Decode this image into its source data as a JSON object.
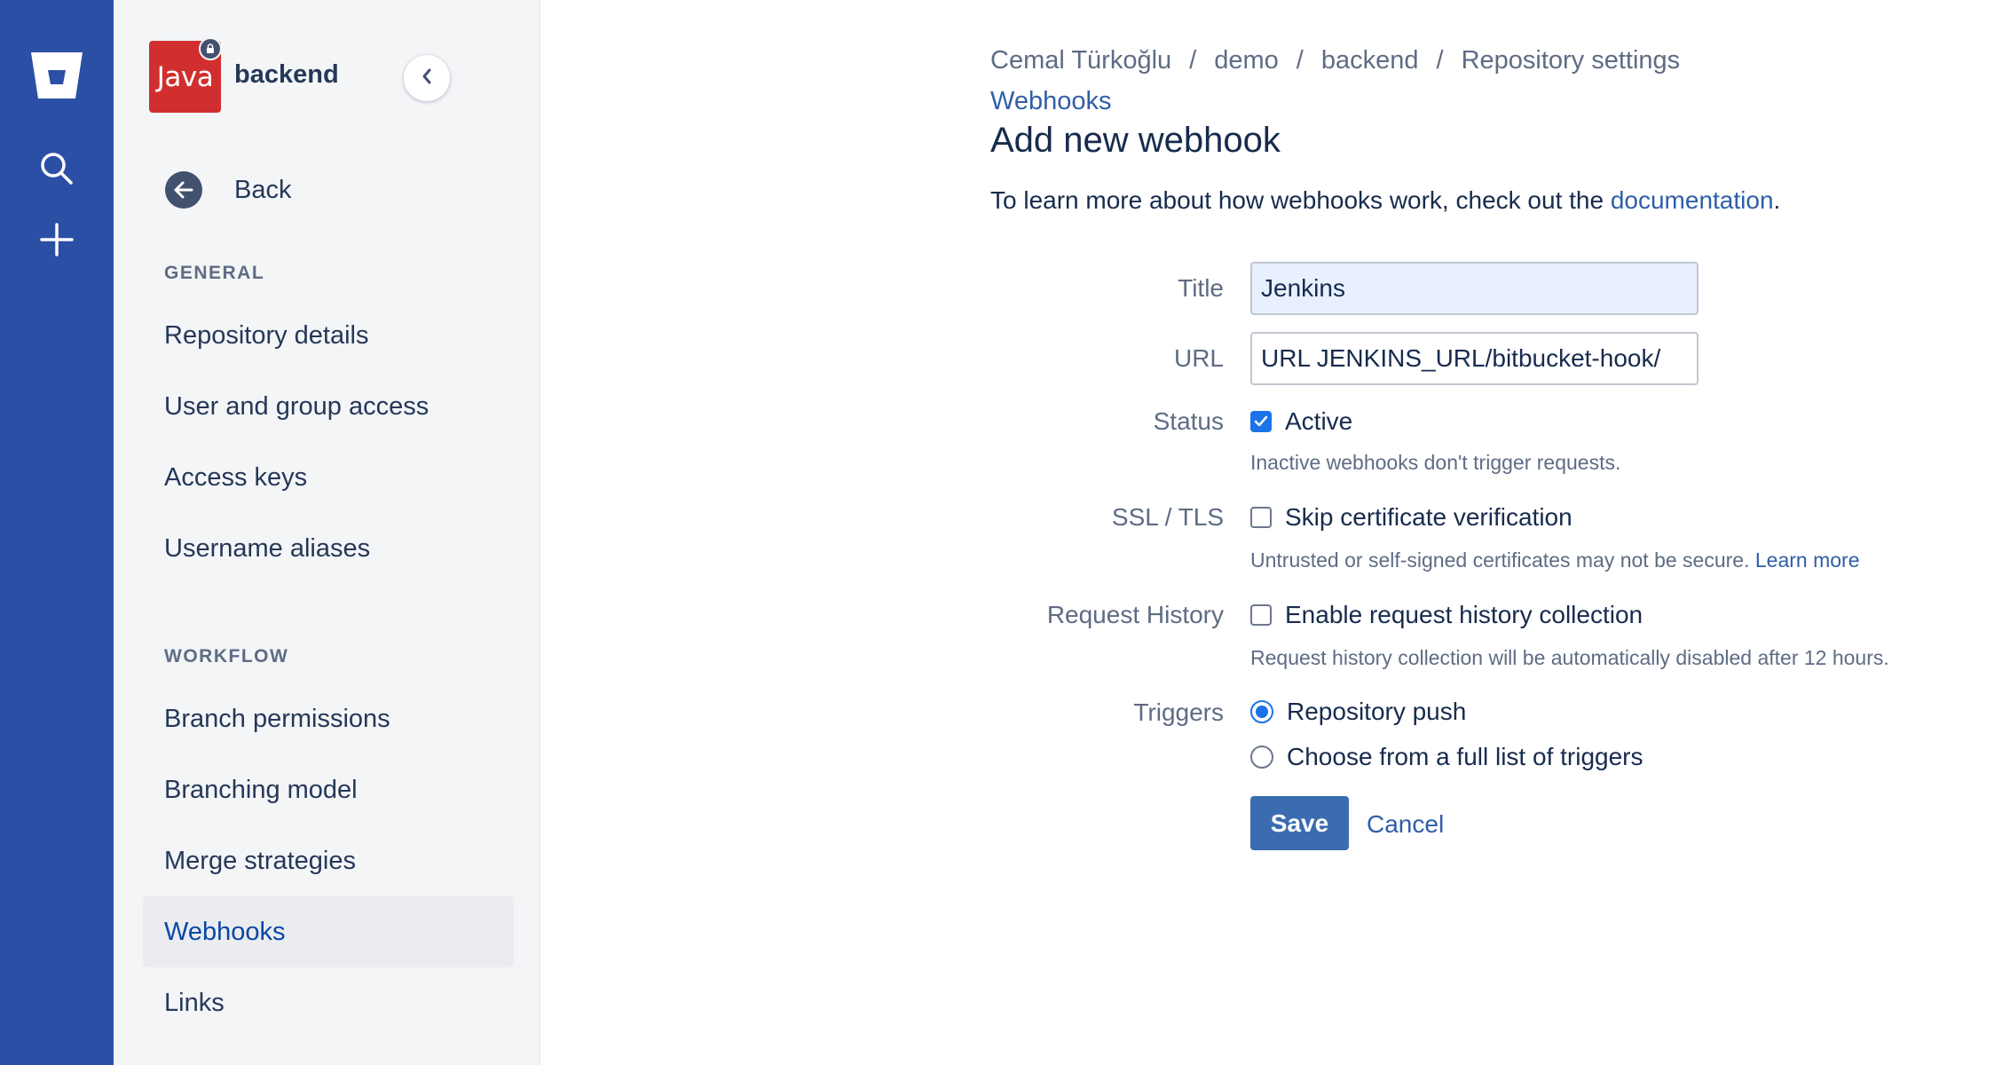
{
  "global_nav": {
    "logo_icon": "bitbucket-logo-icon",
    "search_icon": "search-icon",
    "create_icon": "plus-icon",
    "color": "#2c4fa6"
  },
  "sidebar": {
    "avatar_text": "Java",
    "repo_name": "backend",
    "back_label": "Back",
    "sections": [
      {
        "heading": "GENERAL",
        "items": [
          "Repository details",
          "User and group access",
          "Access keys",
          "Username aliases"
        ]
      },
      {
        "heading": "WORKFLOW",
        "items": [
          "Branch permissions",
          "Branching model",
          "Merge strategies",
          "Webhooks",
          "Links"
        ]
      }
    ],
    "selected_item": "Webhooks"
  },
  "breadcrumb": {
    "items": [
      "Cemal Türkoğlu",
      "demo",
      "backend",
      "Repository settings"
    ],
    "separator": "/",
    "current_section": "Webhooks"
  },
  "page": {
    "title": "Add new webhook",
    "intro_text": "To learn more about how webhooks work, check out the ",
    "intro_link": "documentation",
    "intro_end": "."
  },
  "form": {
    "title_label": "Title",
    "title_value": "Jenkins",
    "url_label": "URL",
    "url_value": "URL JENKINS_URL/bitbucket-hook/",
    "status_label": "Status",
    "status_option": "Active",
    "status_checked": true,
    "status_help": "Inactive webhooks don't trigger requests.",
    "ssl_label": "SSL / TLS",
    "ssl_option": "Skip certificate verification",
    "ssl_checked": false,
    "ssl_help": "Untrusted or self-signed certificates may not be secure. ",
    "ssl_help_link": "Learn more",
    "history_label": "Request History",
    "history_option": "Enable request history collection",
    "history_checked": false,
    "history_help": "Request history collection will be automatically disabled after 12 hours.",
    "triggers_label": "Triggers",
    "trigger_push": "Repository push",
    "trigger_full": "Choose from a full list of triggers",
    "selected_trigger": "Repository push",
    "save_label": "Save",
    "cancel_label": "Cancel"
  },
  "colors": {
    "accent": "#1a73e8",
    "link": "#2f5ea8",
    "primary_button": "#3b6cb0",
    "avatar": "#d12f2f"
  }
}
